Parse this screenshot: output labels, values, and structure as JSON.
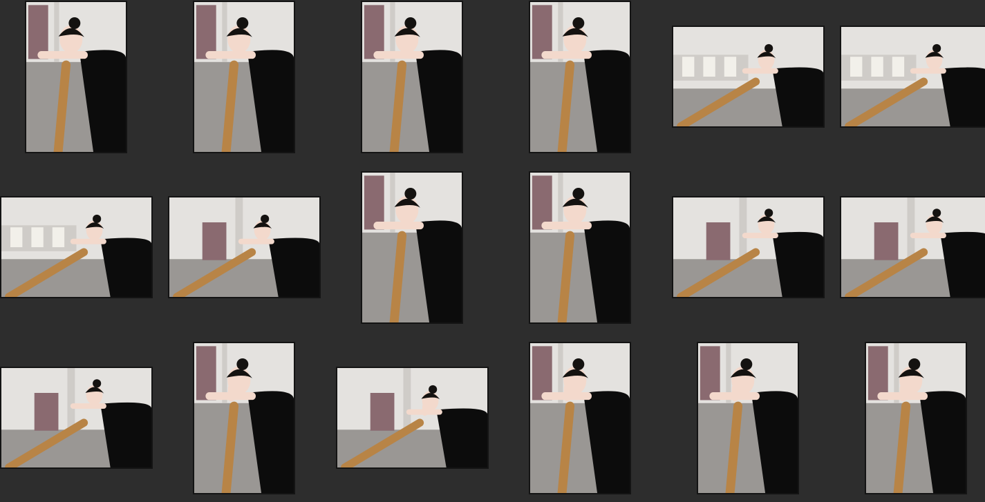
{
  "app": {
    "view": "photo-thumbnail-grid",
    "background_color": "#2d2d2d",
    "thumbnail_border_color": "#141414"
  },
  "photo_palette": {
    "wall": "#e4e2df",
    "wall_shade": "#cfccc8",
    "floor": "#9a9794",
    "door": "#8a6a70",
    "window": "#f2f0ea",
    "barre": "#b88446",
    "barre_stand": "#f4f4f4",
    "skin": "#f3d9cc",
    "hair": "#141210",
    "dress": "#0c0c0c"
  },
  "thumbnails": [
    {
      "pose": "portrait-arms-folded"
    },
    {
      "pose": "portrait-arms-folded"
    },
    {
      "pose": "portrait-arms-folded"
    },
    {
      "pose": "portrait-arms-folded"
    },
    {
      "pose": "landscape-window-smile"
    },
    {
      "pose": "landscape-window-smile"
    },
    {
      "pose": "landscape-window-smile"
    },
    {
      "pose": "landscape-head-tilt-door"
    },
    {
      "pose": "portrait-head-tilt"
    },
    {
      "pose": "portrait-head-tilt"
    },
    {
      "pose": "landscape-head-down"
    },
    {
      "pose": "landscape-head-down"
    },
    {
      "pose": "landscape-head-down"
    },
    {
      "pose": "portrait-chin-in-hand"
    },
    {
      "pose": "landscape-chin-in-hand"
    },
    {
      "pose": "portrait-chin-in-hand"
    },
    {
      "pose": "portrait-chin-in-hand"
    },
    {
      "pose": "portrait-chin-in-hand"
    }
  ]
}
